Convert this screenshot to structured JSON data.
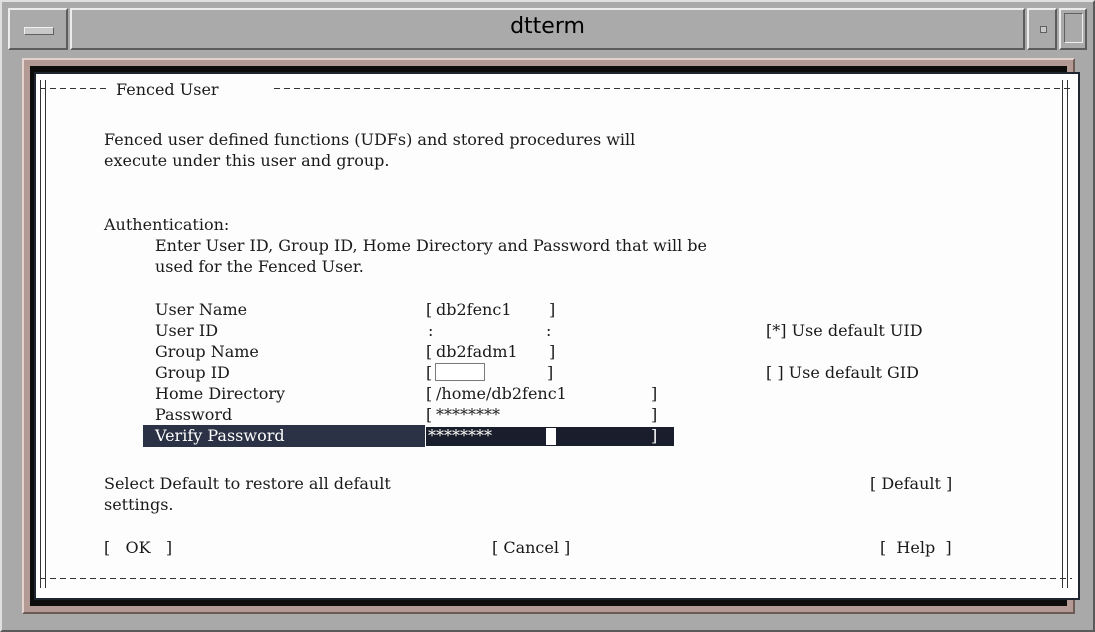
{
  "window": {
    "title": "dtterm"
  },
  "dialog": {
    "heading": "Fenced User",
    "intro_line1": "Fenced user defined functions (UDFs) and stored procedures will",
    "intro_line2": "execute under this user and group.",
    "auth_label": "Authentication:",
    "auth_line1": "Enter User ID, Group ID, Home Directory and Password that will be",
    "auth_line2": "used for the Fenced User.",
    "fields": {
      "user_name": {
        "label": "User Name",
        "value": "db2fenc1"
      },
      "user_id": {
        "label": "User ID",
        "value": ""
      },
      "group_name": {
        "label": "Group Name",
        "value": "db2fadm1"
      },
      "group_id": {
        "label": "Group ID",
        "value": ""
      },
      "home_directory": {
        "label": "Home Directory",
        "value": "/home/db2fenc1"
      },
      "password": {
        "label": "Password",
        "value": "********"
      },
      "verify_password": {
        "label": "Verify Password",
        "value": "********"
      }
    },
    "use_default_uid": "[*] Use default UID",
    "use_default_gid": "[ ] Use default GID",
    "default_desc_line1": "Select Default to restore all default",
    "default_desc_line2": "settings.",
    "default_button": "[ Default ]",
    "ok_button": "[   OK   ]",
    "cancel_button": "[ Cancel ]",
    "help_button": "[  Help  ]"
  }
}
